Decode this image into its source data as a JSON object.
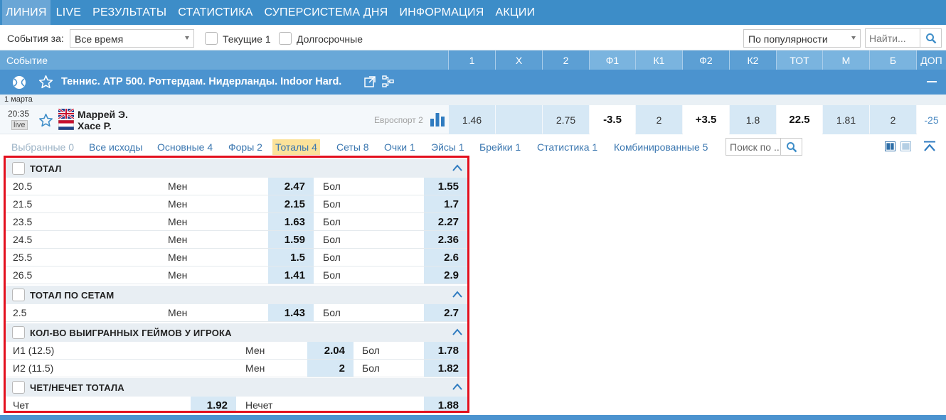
{
  "nav": {
    "items": [
      "ЛИНИЯ",
      "LIVE",
      "РЕЗУЛЬТАТЫ",
      "СТАТИСТИКА",
      "СУПЕРСИСТЕМА ДНЯ",
      "ИНФОРМАЦИЯ",
      "АКЦИИ"
    ],
    "active": "ЛИНИЯ"
  },
  "filters": {
    "events_label": "События за:",
    "period_value": "Все время",
    "current_label": "Текущие 1",
    "longterm_label": "Долгосрочные",
    "sort_value": "По популярности",
    "search_placeholder": "Найти..."
  },
  "columns": {
    "event_label": "Событие",
    "headers": [
      "1",
      "X",
      "2",
      "Ф1",
      "К1",
      "Ф2",
      "К2",
      "ТОТ",
      "М",
      "Б",
      "ДОП"
    ]
  },
  "tournament": {
    "title": "Теннис. ATP 500. Роттердам. Нидерланды. Indoor Hard."
  },
  "date_label": "1 марта",
  "match": {
    "time": "20:35",
    "live": "live",
    "team1": "Маррей Э.",
    "team2": "Хасе Р.",
    "channel": "Евроспорт 2",
    "odds": [
      "1.46",
      "",
      "2.75",
      "-3.5",
      "2",
      "+3.5",
      "1.8",
      "22.5",
      "1.81",
      "2",
      "-25"
    ]
  },
  "tabs": {
    "items": [
      "Выбранные 0",
      "Все исходы",
      "Основные 4",
      "Форы 2",
      "Тоталы 4",
      "Сеты 8",
      "Очки 1",
      "Эйсы 1",
      "Брейки 1",
      "Статистика 1",
      "Комбинированные 5"
    ],
    "active": "Тоталы 4",
    "search_placeholder": "Поиск по ..."
  },
  "markets": {
    "total": {
      "title": "ТОТАЛ",
      "under_label": "Мен",
      "over_label": "Бол",
      "rows": [
        {
          "line": "20.5",
          "under": "2.47",
          "over": "1.55"
        },
        {
          "line": "21.5",
          "under": "2.15",
          "over": "1.7"
        },
        {
          "line": "23.5",
          "under": "1.63",
          "over": "2.27"
        },
        {
          "line": "24.5",
          "under": "1.59",
          "over": "2.36"
        },
        {
          "line": "25.5",
          "under": "1.5",
          "over": "2.6"
        },
        {
          "line": "26.5",
          "under": "1.41",
          "over": "2.9"
        }
      ]
    },
    "sets_total": {
      "title": "ТОТАЛ ПО СЕТАМ",
      "under_label": "Мен",
      "over_label": "Бол",
      "rows": [
        {
          "line": "2.5",
          "under": "1.43",
          "over": "2.7"
        }
      ]
    },
    "games_won": {
      "title": "КОЛ-ВО ВЫИГРАННЫХ ГЕЙМОВ У ИГРОКА",
      "under_label": "Мен",
      "over_label": "Бол",
      "rows": [
        {
          "line": "И1 (12.5)",
          "under": "2.04",
          "over": "1.78"
        },
        {
          "line": "И2 (11.5)",
          "under": "2",
          "over": "1.82"
        }
      ]
    },
    "odd_even": {
      "title": "ЧЕТ/НЕЧЕТ ТОТАЛА",
      "even_label": "Чет",
      "even_odd": "1.92",
      "odd_label": "Нечет",
      "odd_odd": "1.88"
    }
  },
  "colors": {
    "nav_bg": "#3d8dc8",
    "header_bg": "#69a8d8",
    "tournament_bg": "#4b93cf",
    "odds_cell": "#d6e8f5",
    "active_tab": "#fbe29a",
    "highlight_border": "#e3101e"
  }
}
